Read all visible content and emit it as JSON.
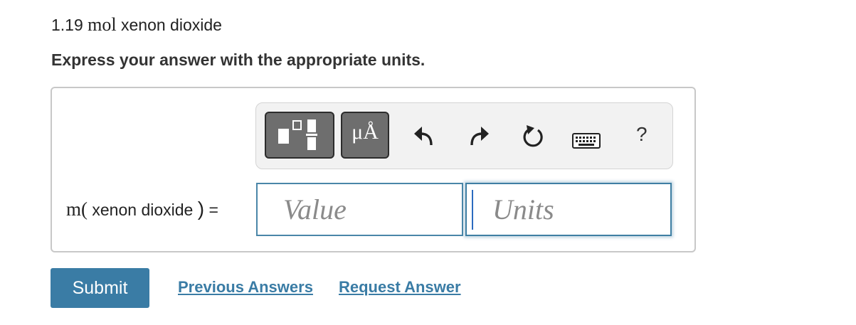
{
  "question": {
    "amount": "1.19",
    "unit": "mol",
    "substance": "xenon dioxide"
  },
  "instruction": "Express your answer with the appropriate units.",
  "toolbar": {
    "units_glyph": "μÅ",
    "help_label": "?",
    "buttons": [
      "templates-icon",
      "units-icon",
      "undo-icon",
      "redo-icon",
      "reset-icon",
      "keyboard-icon",
      "help-icon"
    ]
  },
  "answer": {
    "label_func": "m(",
    "label_substance": "xenon dioxide",
    "label_close": ")",
    "equals": "=",
    "value_placeholder": "Value",
    "units_placeholder": "Units"
  },
  "actions": {
    "submit": "Submit",
    "previous_answers": "Previous Answers",
    "request_answer": "Request Answer"
  },
  "colors": {
    "accent": "#3a7ca5",
    "toolbar_button": "#6e6e6e",
    "toolbar_bg": "#f2f2f2"
  }
}
